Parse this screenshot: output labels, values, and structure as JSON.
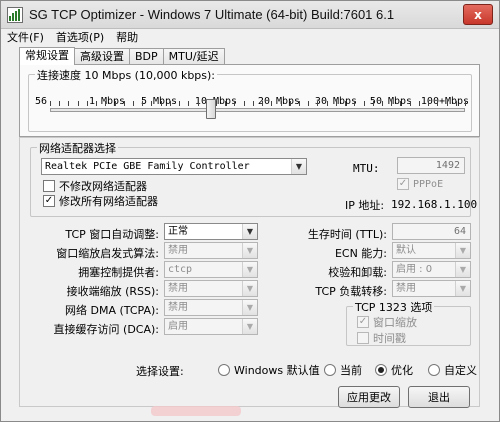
{
  "window": {
    "title": "SG TCP Optimizer - Windows 7 Ultimate (64-bit) Build:7601 6.1",
    "close_label": "x"
  },
  "menu": [
    "文件(F)",
    "首选项(P)",
    "帮助"
  ],
  "tabs": [
    "常规设置",
    "高级设置",
    "BDP",
    "MTU/延迟"
  ],
  "speed": {
    "legend": "连接速度  10 Mbps (10,000 kbps):",
    "labels": [
      "56",
      "1 Mbps",
      "5 Mbps",
      "10 Mbps",
      "20 Mbps",
      "30 Mbps",
      "50 Mbps",
      "100+Mbps"
    ],
    "slider_value": "10 Mbps"
  },
  "adapter": {
    "legend": "网络适配器选择",
    "selected": "Realtek PCIe GBE Family Controller",
    "no_modify_label": "不修改网络适配器",
    "no_modify_checked": false,
    "modify_all_label": "修改所有网络适配器",
    "modify_all_checked": true,
    "mtu_label": "MTU:",
    "mtu_value": "1492",
    "pppoe_label": "PPPoE",
    "pppoe_checked": true,
    "ip_label": "IP 地址:",
    "ip_value": "192.168.1.100"
  },
  "left_settings": [
    {
      "label": "TCP 窗口自动调整:",
      "value": "正常",
      "disabled": false
    },
    {
      "label": "窗口缩放启发式算法:",
      "value": "禁用",
      "disabled": true
    },
    {
      "label": "拥塞控制提供者:",
      "value": "ctcp",
      "disabled": true
    },
    {
      "label": "接收端缩放 (RSS):",
      "value": "禁用",
      "disabled": true
    },
    {
      "label": "网络 DMA (TCPA):",
      "value": "禁用",
      "disabled": true
    },
    {
      "label": "直接缓存访问 (DCA):",
      "value": "启用",
      "disabled": true
    }
  ],
  "right_settings": {
    "ttl_label": "生存时间 (TTL):",
    "ttl_value": "64",
    "ecn_label": "ECN 能力:",
    "ecn_value": "默认",
    "checksum_label": "校验和卸载:",
    "checksum_value": "启用 : 0",
    "chimney_label": "TCP 负载转移:",
    "chimney_value": "禁用"
  },
  "tcp1323": {
    "legend": "TCP 1323 选项",
    "window_scaling_label": "窗口缩放",
    "window_scaling_checked": true,
    "timestamps_label": "时间戳",
    "timestamps_checked": false
  },
  "choose": {
    "label": "选择设置:",
    "options": [
      "Windows 默认值",
      "当前",
      "优化",
      "自定义"
    ],
    "selected_index": 2
  },
  "buttons": {
    "apply": "应用更改",
    "exit": "退出"
  },
  "colors": {
    "window_bg": "#f0f0f0",
    "close_red": "#c7372a",
    "disabled_text": "#8f8f8f"
  }
}
